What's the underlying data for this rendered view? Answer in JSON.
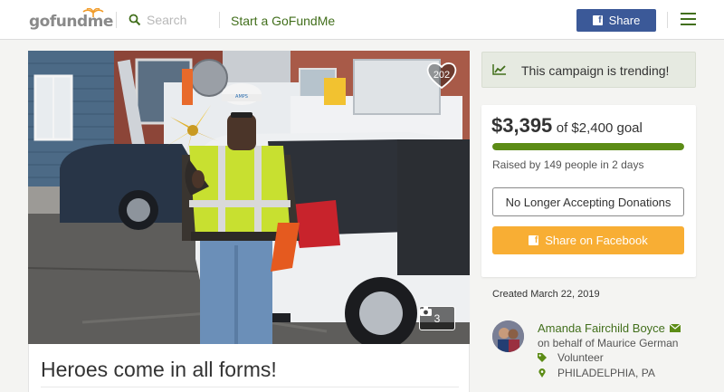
{
  "header": {
    "logo_text": "gofundme",
    "search_label": "Search",
    "start_link": "Start a GoFundMe",
    "share_label": "Share",
    "fb_letter": "f"
  },
  "photo": {
    "heart_count": "202",
    "photo_count": "3",
    "vest_badge": "AMPS"
  },
  "campaign": {
    "title": "Heroes come in all forms!"
  },
  "sidebar": {
    "trending_text": "This campaign is trending!",
    "raised_amount": "$3,395",
    "goal_text": "of $2,400 goal",
    "progress_fraction": 1.0,
    "raised_by": "Raised by 149 people in 2 days",
    "no_longer_label": "No Longer Accepting Donations",
    "fb_share_label": "Share on Facebook",
    "created": "Created March 22, 2019",
    "organizer_name": "Amanda Fairchild Boyce",
    "on_behalf": "on behalf of Maurice German",
    "tag": "Volunteer",
    "location": "PHILADELPHIA, PA"
  },
  "colors": {
    "brand_green": "#426f1c",
    "progress_green": "#5c8c16",
    "facebook_blue": "#3b5998",
    "share_orange": "#f8ae34",
    "trending_bg": "#e6eae1"
  },
  "icons": [
    "logo-sprout-icon",
    "search-icon",
    "facebook-icon",
    "hamburger-menu-icon",
    "heart-icon",
    "camera-icon",
    "trending-chart-icon",
    "mail-icon",
    "tag-icon",
    "map-pin-icon"
  ]
}
